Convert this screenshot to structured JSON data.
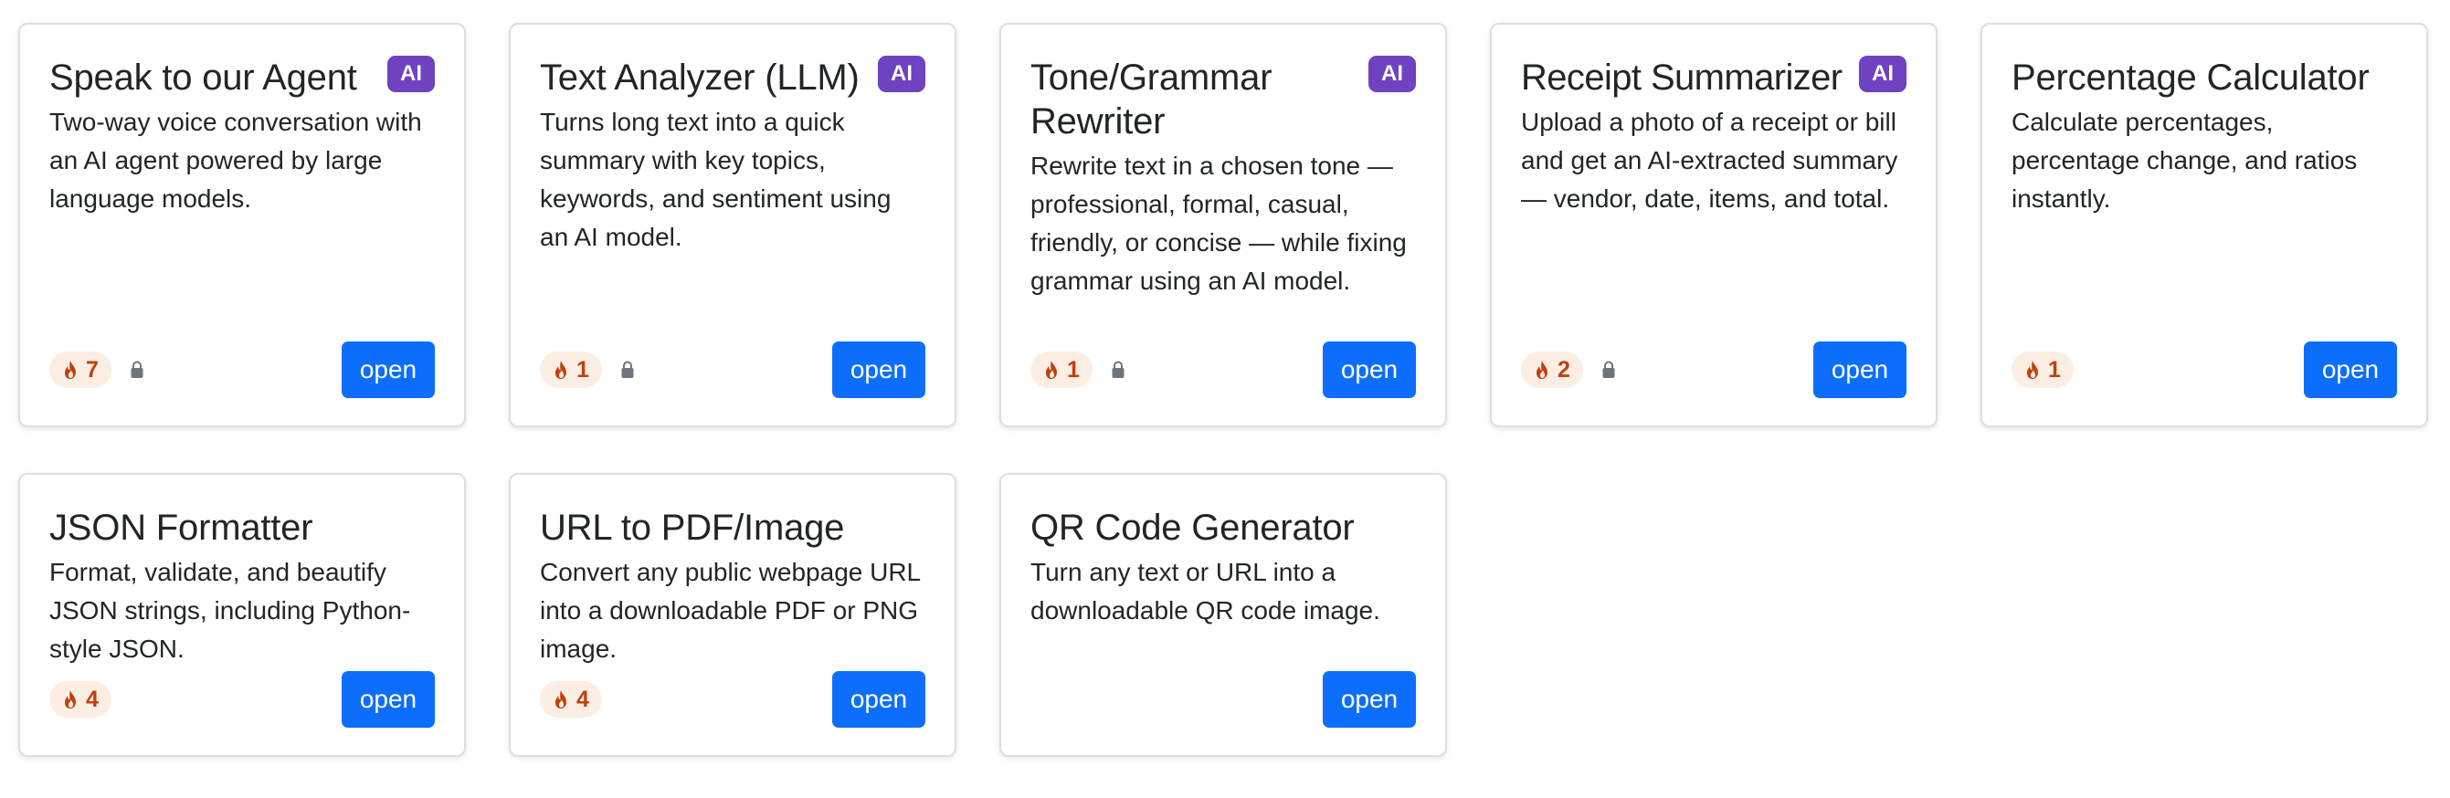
{
  "cards": [
    {
      "title": "Speak to our Agent",
      "ai_badge": "AI",
      "description": "Two-way voice conversation with an AI agent powered by large language models.",
      "popularity": "7",
      "locked": true,
      "open_label": "open"
    },
    {
      "title": "Text Analyzer (LLM)",
      "ai_badge": "AI",
      "description": "Turns long text into a quick summary with key topics, keywords, and sentiment using an AI model.",
      "popularity": "1",
      "locked": true,
      "open_label": "open"
    },
    {
      "title": "Tone/Grammar Rewriter",
      "ai_badge": "AI",
      "description": "Rewrite text in a chosen tone — professional, formal, casual, friendly, or concise — while fixing grammar using an AI model.",
      "popularity": "1",
      "locked": true,
      "open_label": "open"
    },
    {
      "title": "Receipt Summarizer",
      "ai_badge": "AI",
      "description": "Upload a photo of a receipt or bill and get an AI-extracted summary — vendor, date, items, and total.",
      "popularity": "2",
      "locked": true,
      "open_label": "open"
    },
    {
      "title": "Percentage Calculator",
      "description": "Calculate percentages, percentage change, and ratios instantly.",
      "popularity": "1",
      "locked": false,
      "open_label": "open"
    },
    {
      "title": "JSON Formatter",
      "description": "Format, validate, and beautify JSON strings, including Python-style JSON.",
      "popularity": "4",
      "locked": false,
      "open_label": "open"
    },
    {
      "title": "URL to PDF/Image",
      "description": "Convert any public webpage URL into a downloadable PDF or PNG image.",
      "popularity": "4",
      "locked": false,
      "open_label": "open"
    },
    {
      "title": "QR Code Generator",
      "description": "Turn any text or URL into a downloadable QR code image.",
      "locked": false,
      "open_label": "open"
    }
  ],
  "icons": {
    "flame": "fire-icon",
    "lock": "lock-icon"
  },
  "colors": {
    "ai_badge": "#6f42c1",
    "open_button": "#0d6efd",
    "flame_badge_bg": "#fdeee3",
    "flame_badge_text": "#c0400e",
    "lock": "#6c757d"
  }
}
